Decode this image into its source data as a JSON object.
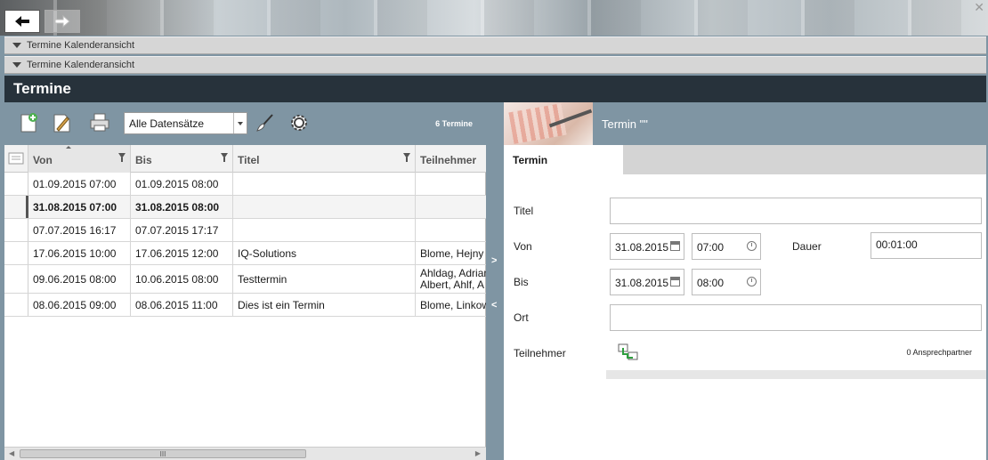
{
  "window": {
    "close_glyph": "✕"
  },
  "nav": {
    "back_icon": "arrow-left-icon",
    "forward_icon": "arrow-right-icon"
  },
  "collapsed_sections": [
    {
      "label": "Termine Kalenderansicht"
    },
    {
      "label": "Termine Kalenderansicht"
    }
  ],
  "page_title": "Termine",
  "toolbar": {
    "filter_select": {
      "value": "Alle Datensätze"
    },
    "record_count": "6 Termine",
    "icons": [
      "add-record-icon",
      "edit-icon",
      "print-icon",
      "brush-icon",
      "gear-icon"
    ]
  },
  "grid": {
    "columns": [
      {
        "label": "Von",
        "filterable": true
      },
      {
        "label": "Bis",
        "filterable": true
      },
      {
        "label": "Titel",
        "filterable": true
      },
      {
        "label": "Teilnehmer",
        "filterable": false
      }
    ],
    "rows": [
      {
        "von": "01.09.2015 07:00",
        "bis": "01.09.2015 08:00",
        "titel": "",
        "teilnehmer": "",
        "teilnehmer2": "",
        "selected": false
      },
      {
        "von": "31.08.2015 07:00",
        "bis": "31.08.2015 08:00",
        "titel": "",
        "teilnehmer": "",
        "teilnehmer2": "",
        "selected": true
      },
      {
        "von": "07.07.2015 16:17",
        "bis": "07.07.2015 17:17",
        "titel": "",
        "teilnehmer": "",
        "teilnehmer2": "",
        "selected": false
      },
      {
        "von": "17.06.2015 10:00",
        "bis": "17.06.2015 12:00",
        "titel": "IQ-Solutions",
        "teilnehmer": "Blome, Hejny",
        "teilnehmer2": "",
        "selected": false
      },
      {
        "von": "09.06.2015 08:00",
        "bis": "10.06.2015 08:00",
        "titel": "Testtermin",
        "teilnehmer": "Ahldag, Adrian",
        "teilnehmer2": "Albert, Ahlf, A",
        "selected": false
      },
      {
        "von": "08.06.2015 09:00",
        "bis": "08.06.2015 11:00",
        "titel": "Dies ist ein Termin",
        "teilnehmer": "Blome, Linkow",
        "teilnehmer2": "",
        "selected": false
      }
    ],
    "scroll_thumb_glyph": "III"
  },
  "splitter": {
    "expand": ">",
    "collapse": "<"
  },
  "detail": {
    "title": "Termin \"\"",
    "tabs": [
      {
        "label": "Termin"
      }
    ],
    "fields": {
      "titel": {
        "label": "Titel",
        "value": ""
      },
      "von": {
        "label": "Von",
        "date": "31.08.2015",
        "time": "07:00"
      },
      "dauer": {
        "label": "Dauer",
        "value": "00:01:00"
      },
      "bis": {
        "label": "Bis",
        "date": "31.08.2015",
        "time": "08:00"
      },
      "ort": {
        "label": "Ort",
        "value": ""
      },
      "teilnehmer": {
        "label": "Teilnehmer",
        "count": "0 Ansprechpartner"
      }
    }
  }
}
